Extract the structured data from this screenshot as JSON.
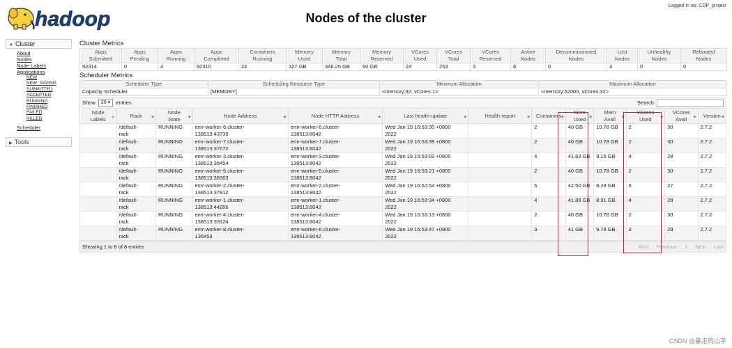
{
  "header": {
    "logo_text": "hadoop",
    "title": "Nodes of the cluster",
    "login": "Logged in as: CDP_project"
  },
  "sidebar": {
    "cluster": "Cluster",
    "links": [
      "About",
      "Nodes",
      "Node Labels",
      "Applications"
    ],
    "app_states": [
      "NEW",
      "NEW_SAVING",
      "SUBMITTED",
      "ACCEPTED",
      "RUNNING",
      "FINISHED",
      "FAILED",
      "KILLED"
    ],
    "scheduler": "Scheduler",
    "tools": "Tools"
  },
  "cluster_metrics": {
    "title": "Cluster Metrics",
    "headers": [
      [
        "Apps",
        "Submitted"
      ],
      [
        "Apps",
        "Pending"
      ],
      [
        "Apps",
        "Running"
      ],
      [
        "Apps",
        "Completed"
      ],
      [
        "Containers",
        "Running"
      ],
      [
        "Memory",
        "Used"
      ],
      [
        "Memory",
        "Total"
      ],
      [
        "Memory",
        "Reserved"
      ],
      [
        "VCores",
        "Used"
      ],
      [
        "VCores",
        "Total"
      ],
      [
        "VCores",
        "Reserved"
      ],
      [
        "Active",
        "Nodes"
      ],
      [
        "Decommissioned",
        "Nodes"
      ],
      [
        "Lost",
        "Nodes"
      ],
      [
        "Unhealthy",
        "Nodes"
      ],
      [
        "Rebooted",
        "Nodes"
      ]
    ],
    "values": [
      "92314",
      "0",
      "4",
      "92310",
      "24",
      "327 GB",
      "346.25 GB",
      "60 GB",
      "24",
      "253",
      "3",
      "8",
      "0",
      "4",
      "0",
      "0"
    ]
  },
  "scheduler_metrics": {
    "title": "Scheduler Metrics",
    "headers": [
      "Scheduler Type",
      "Scheduling Resource Type",
      "Minimum Allocation",
      "Maximum Allocation"
    ],
    "values": [
      "Capacity Scheduler",
      "[MEMORY]",
      "<memory:32, vCores:1>",
      "<memory:52000, vCores:32>"
    ]
  },
  "controls": {
    "show": "Show",
    "entries_value": "20",
    "entries": "entries",
    "search": "Search:"
  },
  "nodes_table": {
    "headers": [
      [
        "Node",
        "Labels"
      ],
      [
        "Rack",
        ""
      ],
      [
        "Node",
        "State"
      ],
      [
        "Node Address",
        ""
      ],
      [
        "Node HTTP Address",
        ""
      ],
      [
        "Last health-update",
        ""
      ],
      [
        "Health-report",
        ""
      ],
      [
        "Containers",
        ""
      ],
      [
        "Mem",
        "Used"
      ],
      [
        "Mem",
        "Avail"
      ],
      [
        "VCores",
        "Used"
      ],
      [
        "VCores",
        "Avail"
      ],
      [
        "Version",
        ""
      ]
    ],
    "rows": [
      {
        "labels": "",
        "rack_1": "/default-",
        "rack_2": "rack",
        "state": "RUNNING",
        "addr_1": "emr-worker-6.cluster-",
        "addr_2": "138513:43730",
        "http_1": "emr-worker-6.cluster-",
        "http_2": "138513:8042",
        "time_1": "Wed Jan 19 16:53:30 +0800",
        "time_2": "2022",
        "health": "",
        "containers": "2",
        "mem_used": "40 GB",
        "mem_avail": "10.78 GB",
        "vc_used": "2",
        "vc_avail": "30",
        "version": "2.7.2"
      },
      {
        "labels": "",
        "rack_1": "/default-",
        "rack_2": "rack",
        "state": "RUNNING",
        "addr_1": "emr-worker-7.cluster-",
        "addr_2": "138513:37672",
        "http_1": "emr-worker-7.cluster-",
        "http_2": "138513:8042",
        "time_1": "Wed Jan 19 16:53:39 +0800",
        "time_2": "2022",
        "health": "",
        "containers": "2",
        "mem_used": "40 GB",
        "mem_avail": "10.78 GB",
        "vc_used": "2",
        "vc_avail": "30",
        "version": "2.7.2"
      },
      {
        "labels": "",
        "rack_1": "/default-",
        "rack_2": "rack",
        "state": "RUNNING",
        "addr_1": "emr-worker-3.cluster-",
        "addr_2": "138513:36454",
        "http_1": "emr-worker-3.cluster-",
        "http_2": "138513:8042",
        "time_1": "Wed Jan 19 16:53:03 +0800",
        "time_2": "2022",
        "health": "",
        "containers": "4",
        "mem_used": "41.63 GB",
        "mem_avail": "9.16 GB",
        "vc_used": "4",
        "vc_avail": "28",
        "version": "2.7.2"
      },
      {
        "labels": "",
        "rack_1": "/default-",
        "rack_2": "rack",
        "state": "RUNNING",
        "addr_1": "emr-worker-5.cluster-",
        "addr_2": "138513:38363",
        "http_1": "emr-worker-5.cluster-",
        "http_2": "138513:8042",
        "time_1": "Wed Jan 19 16:53:21 +0800",
        "time_2": "2022",
        "health": "",
        "containers": "2",
        "mem_used": "40 GB",
        "mem_avail": "10.78 GB",
        "vc_used": "2",
        "vc_avail": "30",
        "version": "2.7.2"
      },
      {
        "labels": "",
        "rack_1": "/default-",
        "rack_2": "rack",
        "state": "RUNNING",
        "addr_1": "emr-worker-2.cluster-",
        "addr_2": "138513:37812",
        "http_1": "emr-worker-2.cluster-",
        "http_2": "138513:8042",
        "time_1": "Wed Jan 19 16:52:54 +0800",
        "time_2": "2022",
        "health": "",
        "containers": "5",
        "mem_used": "42.50 GB",
        "mem_avail": "8.28 GB",
        "vc_used": "5",
        "vc_avail": "27",
        "version": "2.7.2"
      },
      {
        "labels": "",
        "rack_1": "/default-",
        "rack_2": "rack",
        "state": "RUNNING",
        "addr_1": "emr-worker-1.cluster-",
        "addr_2": "138513:44266",
        "http_1": "emr-worker-1.cluster-",
        "http_2": "138513:8042",
        "time_1": "Wed Jan 19 16:53:34 +0800",
        "time_2": "2022",
        "health": "",
        "containers": "4",
        "mem_used": "41.88 GB",
        "mem_avail": "8.91 GB",
        "vc_used": "4",
        "vc_avail": "28",
        "version": "2.7.2"
      },
      {
        "labels": "",
        "rack_1": "/default-",
        "rack_2": "rack",
        "state": "RUNNING",
        "addr_1": "emr-worker-4.cluster-",
        "addr_2": "138513:33124",
        "http_1": "emr-worker-4.cluster-",
        "http_2": "138513:8042",
        "time_1": "Wed Jan 19 16:53:13 +0800",
        "time_2": "2022",
        "health": "",
        "containers": "2",
        "mem_used": "40 GB",
        "mem_avail": "10.78 GB",
        "vc_used": "2",
        "vc_avail": "30",
        "version": "2.7.2"
      },
      {
        "labels": "",
        "rack_1": "/default-",
        "rack_2": "rack",
        "state": "RUNNING",
        "addr_1": "emr-worker-8.cluster-",
        "addr_2": "136453",
        "http_1": "emr-worker-8.cluster-",
        "http_2": "138513:8042",
        "time_1": "Wed Jan 19 16:53:47 +0800",
        "time_2": "2022",
        "health": "",
        "containers": "3",
        "mem_used": "41 GB",
        "mem_avail": "9.78 GB",
        "vc_used": "3",
        "vc_avail": "29",
        "version": "2.7.2"
      }
    ],
    "summary": "Showing 1 to 8 of 8 entries",
    "pager": [
      "First",
      "Previous",
      "1",
      "Next",
      "Last"
    ]
  },
  "watermark": "CSDN @暴走的山芋",
  "colors": {
    "highlight_box": "#d62222",
    "logo_yellow": "#f5d23c",
    "logo_text": "#1e3f7a"
  }
}
